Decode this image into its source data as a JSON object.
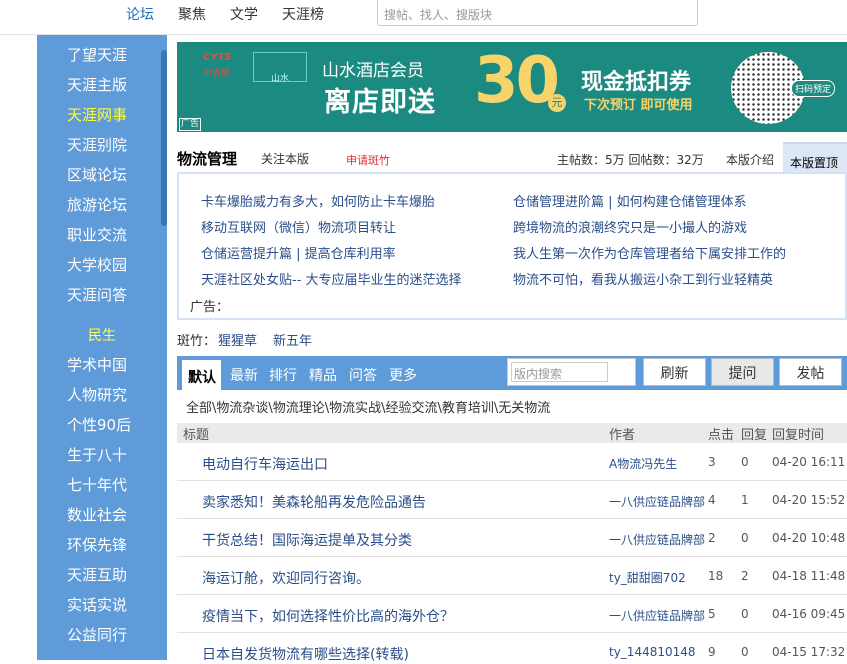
{
  "topnav": {
    "items": [
      "论坛",
      "聚焦",
      "文学",
      "天涯榜"
    ],
    "search_placeholder": "搜帖、找人、搜版块"
  },
  "sidebar": {
    "items": [
      "了望天涯",
      "天涯主版",
      "天涯网事",
      "天涯别院",
      "区域论坛",
      "旅游论坛",
      "职业交流",
      "大学校园",
      "天涯问答"
    ],
    "category": "民生",
    "items2": [
      "学术中国",
      "人物研究",
      "个性90后",
      "生于八十",
      "七十年代",
      "数业社会",
      "环保先锋",
      "天涯互助",
      "实话实说",
      "公益同行"
    ]
  },
  "banner": {
    "logo": "CYTS",
    "logo_sub": "中青旅",
    "brand": "山水",
    "line1": "山水酒店会员",
    "line2": "离店即送",
    "amount": "30",
    "unit": "元",
    "line3": "现金抵扣券",
    "line4": "下次预订 即可使用",
    "qr_button": "扫码预定",
    "ad": "广告"
  },
  "board": {
    "title": "物流管理",
    "follow": "关注本版",
    "apply": "申请斑竹",
    "stats": "主帖数：5万  回帖数：32万",
    "intro": "本版介绍",
    "top": "本版置顶"
  },
  "notice": {
    "left": [
      "卡车爆胎威力有多大，如何防止卡车爆胎",
      "移动互联网（微信）物流项目转让",
      "仓储运营提升篇 | 提高仓库利用率",
      "天涯社区处女贴-- 大专应届毕业生的迷茫选择"
    ],
    "right": [
      "仓储管理进阶篇 | 如何构建仓储管理体系",
      "跨境物流的浪潮终究只是一小撮人的游戏",
      "我人生第一次作为仓库管理者给下属安排工作的",
      "物流不可怕，看我从搬运小杂工到行业轻精英"
    ],
    "ad_label": "广告："
  },
  "moderators": {
    "label": "斑竹：",
    "names": [
      "猩猩草",
      "新五年"
    ]
  },
  "tabs": {
    "items": [
      "默认",
      "最新",
      "排行",
      "精品",
      "问答",
      "更多"
    ],
    "search_placeholder": "版内搜索",
    "refresh": "刷新",
    "ask": "提问",
    "post": "发帖"
  },
  "categories": "全部\\物流杂谈\\物流理论\\物流实战\\经验交流\\教育培训\\无关物流",
  "table": {
    "headers": [
      "标题",
      "作者",
      "点击",
      "回复",
      "回复时间"
    ],
    "rows": [
      {
        "title": "电动自行车海运出口",
        "author": "A物流冯先生",
        "clicks": "3",
        "replies": "0",
        "time": "04-20 16:11"
      },
      {
        "title": "卖家悉知！美森轮船再发危险品通告",
        "author": "一八供应链品牌部",
        "clicks": "4",
        "replies": "1",
        "time": "04-20 15:52"
      },
      {
        "title": "干货总结！国际海运提单及其分类",
        "author": "一八供应链品牌部",
        "clicks": "2",
        "replies": "0",
        "time": "04-20 10:48"
      },
      {
        "title": "海运订舱，欢迎同行咨询。",
        "author": "ty_甜甜圈702",
        "clicks": "18",
        "replies": "2",
        "time": "04-18 11:48"
      },
      {
        "title": "疫情当下，如何选择性价比高的海外仓？",
        "author": "一八供应链品牌部",
        "clicks": "5",
        "replies": "0",
        "time": "04-16 09:45"
      },
      {
        "title": "日本自发货物流有哪些选择(转载)",
        "author": "ty_144810148",
        "clicks": "9",
        "replies": "0",
        "time": "04-15 17:32"
      }
    ]
  },
  "colors": {
    "sidebar": "#5e9bd8",
    "banner": "#1b8a80",
    "link": "#2a4e8a",
    "active": "#ffff33"
  }
}
